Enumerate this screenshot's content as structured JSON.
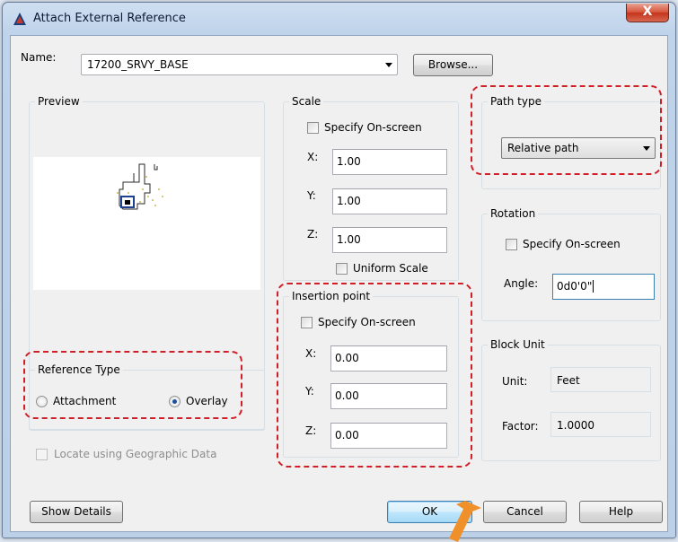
{
  "window": {
    "title": "Attach External Reference",
    "close_label": "X"
  },
  "name_row": {
    "label": "Name:",
    "value": "17200_SRVY_BASE",
    "browse_label": "Browse..."
  },
  "preview": {
    "legend": "Preview"
  },
  "reference_type": {
    "legend": "Reference Type",
    "options": [
      {
        "label": "Attachment",
        "selected": false
      },
      {
        "label": "Overlay",
        "selected": true
      }
    ]
  },
  "locate_geo": {
    "label": "Locate using Geographic Data",
    "checked": false,
    "enabled": false
  },
  "scale": {
    "legend": "Scale",
    "specify_label": "Specify On-screen",
    "fields": [
      {
        "label": "X:",
        "value": "1.00"
      },
      {
        "label": "Y:",
        "value": "1.00"
      },
      {
        "label": "Z:",
        "value": "1.00"
      }
    ],
    "uniform_label": "Uniform Scale"
  },
  "insertion": {
    "legend": "Insertion point",
    "specify_label": "Specify On-screen",
    "fields": [
      {
        "label": "X:",
        "value": "0.00"
      },
      {
        "label": "Y:",
        "value": "0.00"
      },
      {
        "label": "Z:",
        "value": "0.00"
      }
    ]
  },
  "path_type": {
    "legend": "Path type",
    "value": "Relative path"
  },
  "rotation": {
    "legend": "Rotation",
    "specify_label": "Specify On-screen",
    "angle_label": "Angle:",
    "angle_value": "0d0'0\""
  },
  "block_unit": {
    "legend": "Block Unit",
    "unit_label": "Unit:",
    "unit_value": "Feet",
    "factor_label": "Factor:",
    "factor_value": "1.0000"
  },
  "buttons": {
    "show_details": "Show Details",
    "ok": "OK",
    "cancel": "Cancel",
    "help": "Help"
  },
  "colors": {
    "callout": "#d01f26",
    "arrow": "#f0902a",
    "default_button": "#bee6fd"
  }
}
